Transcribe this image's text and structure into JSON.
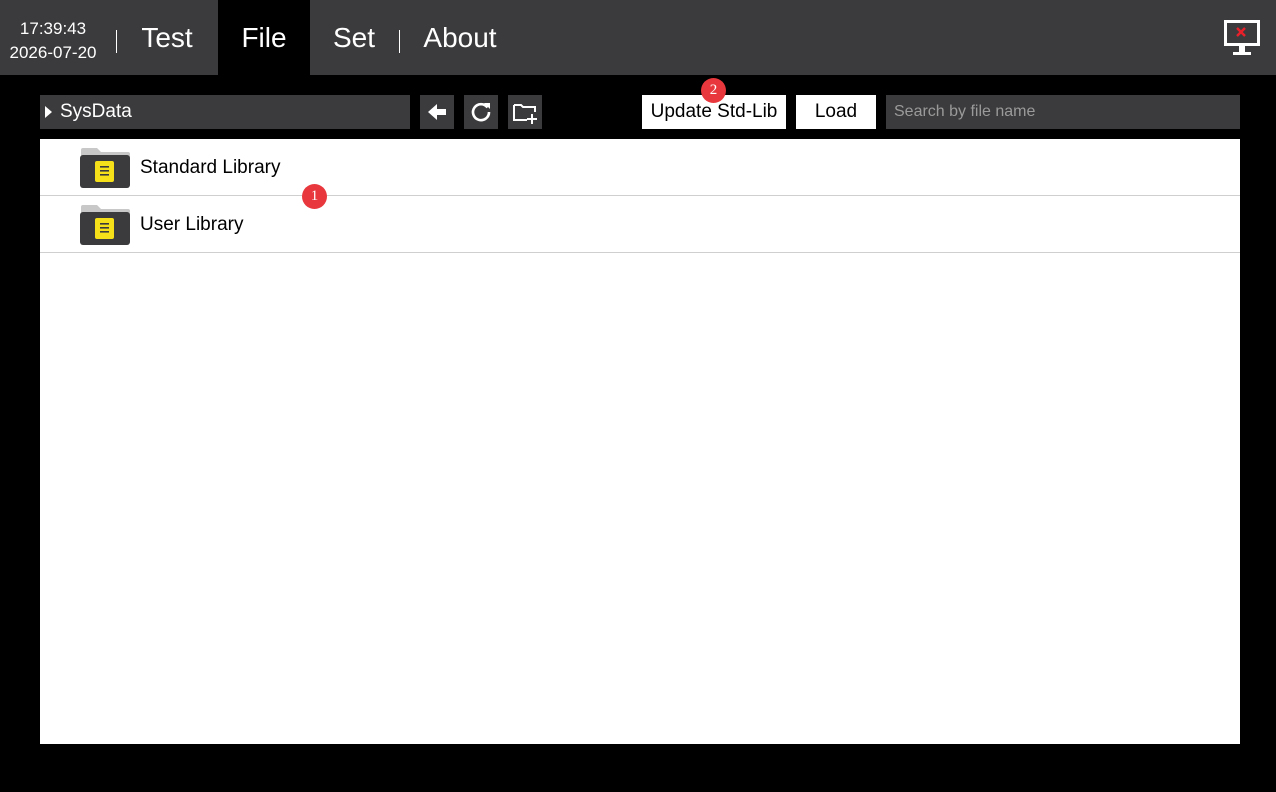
{
  "header": {
    "time": "17:39:43",
    "date": "2026-07-20",
    "tabs": [
      {
        "label": "Test"
      },
      {
        "label": "File"
      },
      {
        "label": "Set"
      },
      {
        "label": "About"
      }
    ],
    "active_tab": "File",
    "monitor_icon": "monitor-close-icon"
  },
  "toolbar": {
    "path": "SysData",
    "back_icon": "arrow-left-icon",
    "refresh_icon": "refresh-icon",
    "new_folder_icon": "folder-add-icon",
    "update_label": "Update Std-Lib",
    "load_label": "Load",
    "search_placeholder": "Search by file name",
    "search_value": ""
  },
  "files": [
    {
      "name": "Standard Library",
      "icon": "folder-icon"
    },
    {
      "name": "User Library",
      "icon": "folder-icon"
    }
  ],
  "markers": [
    {
      "label": "1"
    },
    {
      "label": "2"
    }
  ],
  "colors": {
    "bar": "#3b3b3d",
    "background": "#000000",
    "panel": "#ffffff",
    "folder_badge": "#f5e01a",
    "marker": "#e8383d",
    "close_x": "#e8202a"
  }
}
